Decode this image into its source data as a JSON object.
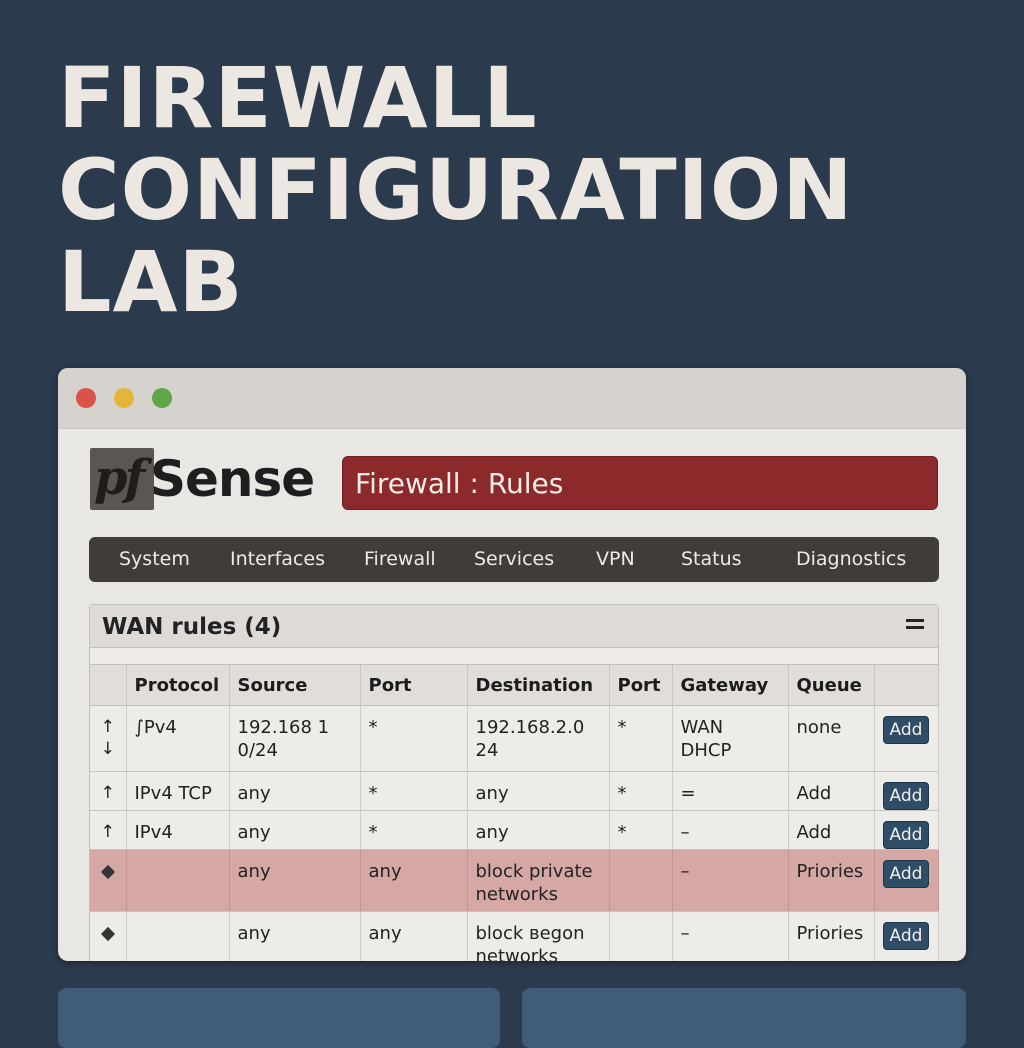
{
  "hero": {
    "lines": [
      "FIREWALL",
      "CONFIGURATION",
      "LAB"
    ]
  },
  "window": {
    "logo": {
      "mark": "pf",
      "text": "Sense"
    },
    "page_title": "Firewall : Rules",
    "nav": [
      "System",
      "Interfaces",
      "Firewall",
      "Services",
      "VPN",
      "Status",
      "Diagnostics"
    ],
    "panel": {
      "title": "WAN rules (4)",
      "columns": [
        "",
        "Protocol",
        "Source",
        "Port",
        "Destination",
        "Port",
        "Gateway",
        "Queue",
        ""
      ],
      "rows": [
        {
          "control": "updown",
          "protocol": "∫Pv4",
          "source": "192.168 1\n0/24",
          "port": "*",
          "destination": "192.168.2.0\n24",
          "dport": "*",
          "gateway": "WAN\nDHCP",
          "queue": "none",
          "action": "Add",
          "blocked": false
        },
        {
          "control": "up",
          "protocol": "IPv4 TCP",
          "source": "any",
          "port": "*",
          "destination": "any",
          "dport": "*",
          "gateway": "=",
          "queue": "Add",
          "action": "Add",
          "blocked": false
        },
        {
          "control": "up",
          "protocol": "IPv4",
          "source": "any",
          "port": "*",
          "destination": "any",
          "dport": "*",
          "gateway": "–",
          "queue": "Add",
          "action": "Add",
          "blocked": false
        },
        {
          "control": "diamond",
          "protocol": "",
          "source": "any",
          "port": "any",
          "destination": "block private\nnetworks",
          "dport": "",
          "gateway": "–",
          "queue": "Priories",
          "action": "Add",
          "blocked": true
        },
        {
          "control": "diamond",
          "protocol": "",
          "source": "any",
          "port": "any",
          "destination": "block вegon\nnetworks",
          "dport": "",
          "gateway": "–",
          "queue": "Priories",
          "action": "Add",
          "blocked": false
        }
      ]
    }
  },
  "colors": {
    "background": "#2b3a4c",
    "banner": "#8c2a2b",
    "navbar": "#3f3c39",
    "blocked_row": "#d6a8a5",
    "button": "#2f4d67",
    "card": "#405c79"
  },
  "icons": {
    "up": "arrow-up-icon",
    "down": "arrow-down-icon",
    "diamond": "diamond-icon",
    "menu": "hamburger-menu-icon"
  }
}
